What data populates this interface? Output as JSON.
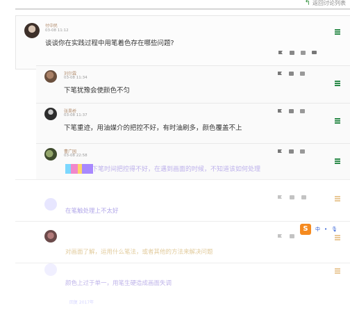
{
  "header": {
    "back_label": "返回讨论列表"
  },
  "main_post": {
    "author": "付中民",
    "timestamp": "03-08 11:12",
    "content": "谈谈你在实践过程中用笔着色存在哪些问题?"
  },
  "replies": [
    {
      "author": "刘尔霖",
      "timestamp": "03-08 11:34",
      "content": "下笔犹豫会使颜色不匀"
    },
    {
      "author": "张昊桥",
      "timestamp": "03-08 11:37",
      "content": "下笔重迹，用油媒介的把控不好，有时油刷多，颜色覆盖不上"
    },
    {
      "author": "曹广园",
      "timestamp": "03-08 22:58",
      "content": "下笔时间把控得不好，在遇到画面的时候，不知道该如何处理"
    }
  ],
  "faded_replies": [
    {
      "author": "",
      "content": "在笔触处理上不太好"
    },
    {
      "author": "",
      "content": "对画面了解，运用什么笔法，或者其他的方法来解决问题"
    },
    {
      "author": "",
      "content": "颜色上过于单一，用笔生硬造成画面失调"
    }
  ],
  "ime": {
    "logo": "S",
    "label": "中"
  },
  "bottom_hint": "回复 2017年",
  "colors": {
    "menu_green": "#2b8a49",
    "name_accent": "#b08a6a",
    "ime_orange": "#f58a1f"
  },
  "icons": {
    "report": "flag-icon",
    "like": "thumbs-up-icon",
    "dislike": "thumbs-down-icon",
    "comment": "comment-icon",
    "menu": "menu-icon"
  }
}
